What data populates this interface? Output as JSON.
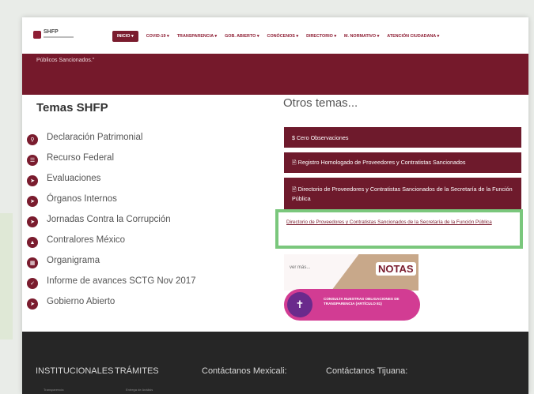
{
  "header": {
    "logo_text": "SHFP",
    "nav": [
      {
        "label": "INICIO ▾",
        "active": true
      },
      {
        "label": "COVID-19 ▾"
      },
      {
        "label": "TRANSPARENCIA ▾"
      },
      {
        "label": "GOB. ABIERTO ▾"
      },
      {
        "label": "CONÓCENOS ▾"
      },
      {
        "label": "DIRECTORIO ▾"
      },
      {
        "label": "M. NORMATIVO ▾"
      },
      {
        "label": "ATENCIÓN CIUDADANA ▾"
      }
    ]
  },
  "banner": {
    "text": "Públicos Sancionados.\""
  },
  "temas": {
    "title": "Temas SHFP",
    "items": [
      {
        "label": "Declaración Patrimonial",
        "icon": "search-icon"
      },
      {
        "label": "Recurso Federal",
        "icon": "database-icon"
      },
      {
        "label": "Evaluaciones",
        "icon": "arrow-icon"
      },
      {
        "label": "Órganos Internos",
        "icon": "arrow-icon"
      },
      {
        "label": "Jornadas Contra la Corrupción",
        "icon": "arrow-icon"
      },
      {
        "label": "Contralores México",
        "icon": "person-icon"
      },
      {
        "label": "Organigrama",
        "icon": "org-icon"
      },
      {
        "label": "Informe de avances SCTG Nov 2017",
        "icon": "check-icon"
      },
      {
        "label": "Gobierno Abierto",
        "icon": "arrow-icon"
      }
    ]
  },
  "otros": {
    "title": "Otros temas...",
    "buttons": [
      {
        "label": "$ Cero Observaciones"
      },
      {
        "label": "🗎 Registro Homologado de Proveedores y Contratistas Sancionados"
      },
      {
        "label": "🗎 Directorio de Proveedores y Contratistas Sancionados de la Secretaría de la Función Pública"
      }
    ],
    "highlighted_link": "Directorio de Proveedores y Contratistas Sancionados de la Secretaría de la Función Pública",
    "notas_vermas": "ver más...",
    "notas_logo": "NOTAS",
    "transparencia_text": "CONSULTA NUESTRAS OBLIGACIONES DE TRANSPARENCIA (ARTÍCULO 81)"
  },
  "footer": {
    "headings": [
      "INSTITUCIONALES",
      "TRÁMITES",
      "Contáctanos Mexicali:",
      "Contáctanos Tijuana:"
    ],
    "sub_links": [
      "Transparencia",
      "Entrega de Análisis"
    ]
  },
  "colors": {
    "primary": "#75192b",
    "footer": "#262626",
    "highlight_border": "#7ac77c"
  }
}
